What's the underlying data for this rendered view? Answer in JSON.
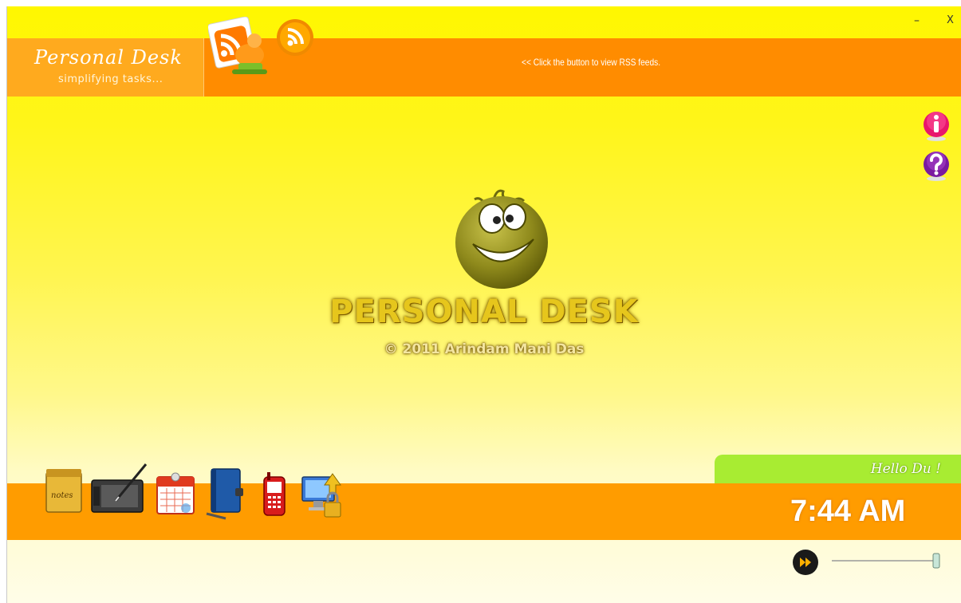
{
  "window": {
    "minimize_label": "–",
    "close_label": "X"
  },
  "header": {
    "app_title": "Personal Desk",
    "tagline": "simplifying tasks...",
    "rss_hint": "<< Click the button to view RSS feeds."
  },
  "logo": {
    "title": "PERSONAL DESK",
    "copyright": "© 2011 Arindam Mani Das"
  },
  "status": {
    "greeting": "Hello Du !",
    "time": "7:44 AM"
  },
  "toolbar": {
    "tools": [
      "notes",
      "drawing-tablet",
      "calendar",
      "address-book",
      "mobile-phone",
      "network-lock"
    ],
    "notes_label": "notes"
  },
  "slider": {
    "value": 1.0
  },
  "colors": {
    "header_orange": "#ff8c00",
    "brand_orange": "#ffaa1e",
    "background_yellow": "#fff700",
    "greeting_green": "#a8ec32",
    "bottom_orange": "#ff9c00"
  }
}
